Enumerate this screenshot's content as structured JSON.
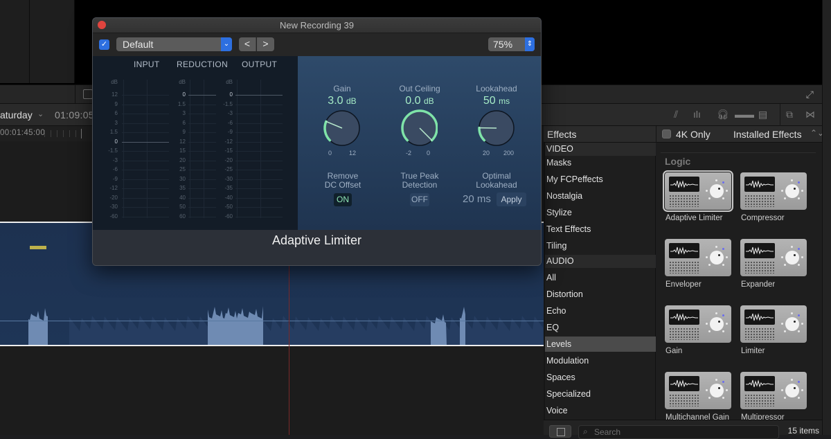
{
  "background_app": {
    "project_name": "aturday",
    "timecode": "01:09:05",
    "ruler_start": "00:01:45:00",
    "ruler_next": "0"
  },
  "plugin_window": {
    "title": "New Recording 39",
    "enabled": true,
    "preset": "Default",
    "prev_label": "<",
    "next_label": ">",
    "zoom": "75%",
    "meters": {
      "titles": [
        "INPUT",
        "REDUCTION",
        "OUTPUT"
      ],
      "unit": "dB",
      "input_scale": [
        "12",
        "9",
        "6",
        "3",
        "1.5",
        "0",
        "-1.5",
        "-3",
        "-6",
        "-9",
        "-12",
        "-20",
        "-30",
        "-60"
      ],
      "reduction_scale": [
        "0",
        "1.5",
        "3",
        "6",
        "9",
        "12",
        "15",
        "20",
        "25",
        "30",
        "35",
        "40",
        "50",
        "60"
      ],
      "output_scale": [
        "0",
        "-1.5",
        "-3",
        "-6",
        "-9",
        "-12",
        "-15",
        "-20",
        "-25",
        "-30",
        "-35",
        "-40",
        "-50",
        "-60"
      ]
    },
    "knobs": [
      {
        "label": "Gain",
        "value": "3.0",
        "unit": "dB",
        "min": "0",
        "max": "12",
        "fraction": 0.25
      },
      {
        "label": "Out Ceiling",
        "value": "0.0",
        "unit": "dB",
        "min": "-2",
        "max": "0",
        "fraction": 1.0
      },
      {
        "label": "Lookahead",
        "value": "50",
        "unit": "ms",
        "min": "20",
        "max": "200",
        "fraction": 0.17
      }
    ],
    "remove_dc_offset": {
      "label_line1": "Remove",
      "label_line2": "DC Offset",
      "state": "ON"
    },
    "true_peak": {
      "label_line1": "True Peak",
      "label_line2": "Detection",
      "state": "OFF"
    },
    "optimal_lookahead": {
      "label_line1": "Optimal",
      "label_line2": "Lookahead",
      "value": "20 ms",
      "apply_label": "Apply"
    },
    "plugin_name": "Adaptive Limiter",
    "accent_color": "#7fe3a8"
  },
  "effects_browser": {
    "title": "Effects",
    "four_k_only_label": "4K Only",
    "four_k_only_checked": false,
    "source_label": "Installed Effects",
    "categories": [
      {
        "label": "VIDEO",
        "type": "header"
      },
      {
        "label": "Masks"
      },
      {
        "label": "My FCPeffects"
      },
      {
        "label": "Nostalgia"
      },
      {
        "label": "Stylize"
      },
      {
        "label": "Text Effects"
      },
      {
        "label": "Tiling"
      },
      {
        "label": "AUDIO",
        "type": "header"
      },
      {
        "label": "All"
      },
      {
        "label": "Distortion"
      },
      {
        "label": "Echo"
      },
      {
        "label": "EQ"
      },
      {
        "label": "Levels",
        "selected": true
      },
      {
        "label": "Modulation"
      },
      {
        "label": "Spaces"
      },
      {
        "label": "Specialized"
      },
      {
        "label": "Voice"
      }
    ],
    "group_label": "Logic",
    "effects": [
      {
        "name": "Adaptive Limiter",
        "selected": true
      },
      {
        "name": "Compressor"
      },
      {
        "name": "Enveloper"
      },
      {
        "name": "Expander"
      },
      {
        "name": "Gain"
      },
      {
        "name": "Limiter"
      },
      {
        "name": "Multichannel Gain"
      },
      {
        "name": "Multipressor"
      }
    ],
    "search_placeholder": "Search",
    "items_count": "15 items"
  }
}
